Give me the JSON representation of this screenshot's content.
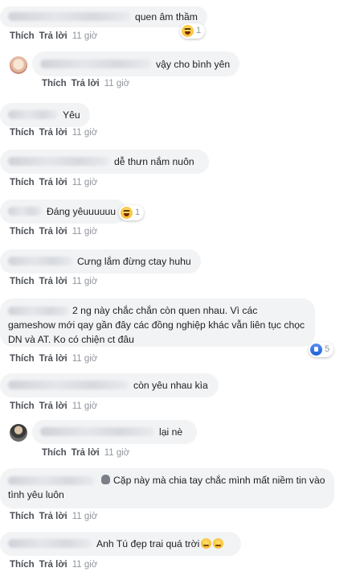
{
  "actions": {
    "like": "Thích",
    "reply": "Trả lời"
  },
  "comments": [
    {
      "text": "quen âm thầm",
      "time": "11 giờ",
      "reaction_count": "1"
    },
    {
      "text": "vậy cho bình yên",
      "time": "11 giờ"
    },
    {
      "text": "Yêu",
      "time": "11 giờ"
    },
    {
      "text": "dễ thưn nắm nuôn",
      "time": "11 giờ"
    },
    {
      "text": "Đáng yêuuuuuu",
      "time": "11 giờ",
      "reaction_count": "1"
    },
    {
      "text": "Cưng lắm đừng ctay huhu",
      "time": "11 giờ"
    },
    {
      "text": "2 ng này chắc chắn còn quen nhau. Vì các gameshow mới qay gần đây các đồng nghiệp khác vẫn liên tục chọc DN và AT. Ko có chiện ct đâu",
      "time": "11 giờ",
      "reaction_count": "5"
    },
    {
      "text": "còn yêu nhau kìa",
      "time": "11 giờ"
    },
    {
      "text": "lại nè",
      "time": "11 giờ"
    },
    {
      "text": "Cặp này mà chia tay chắc mình mất niềm tin vào tình yêu luôn",
      "time": "11 giờ"
    },
    {
      "text": "Anh Tú đẹp trai quá trời",
      "time": "11 giờ"
    }
  ]
}
